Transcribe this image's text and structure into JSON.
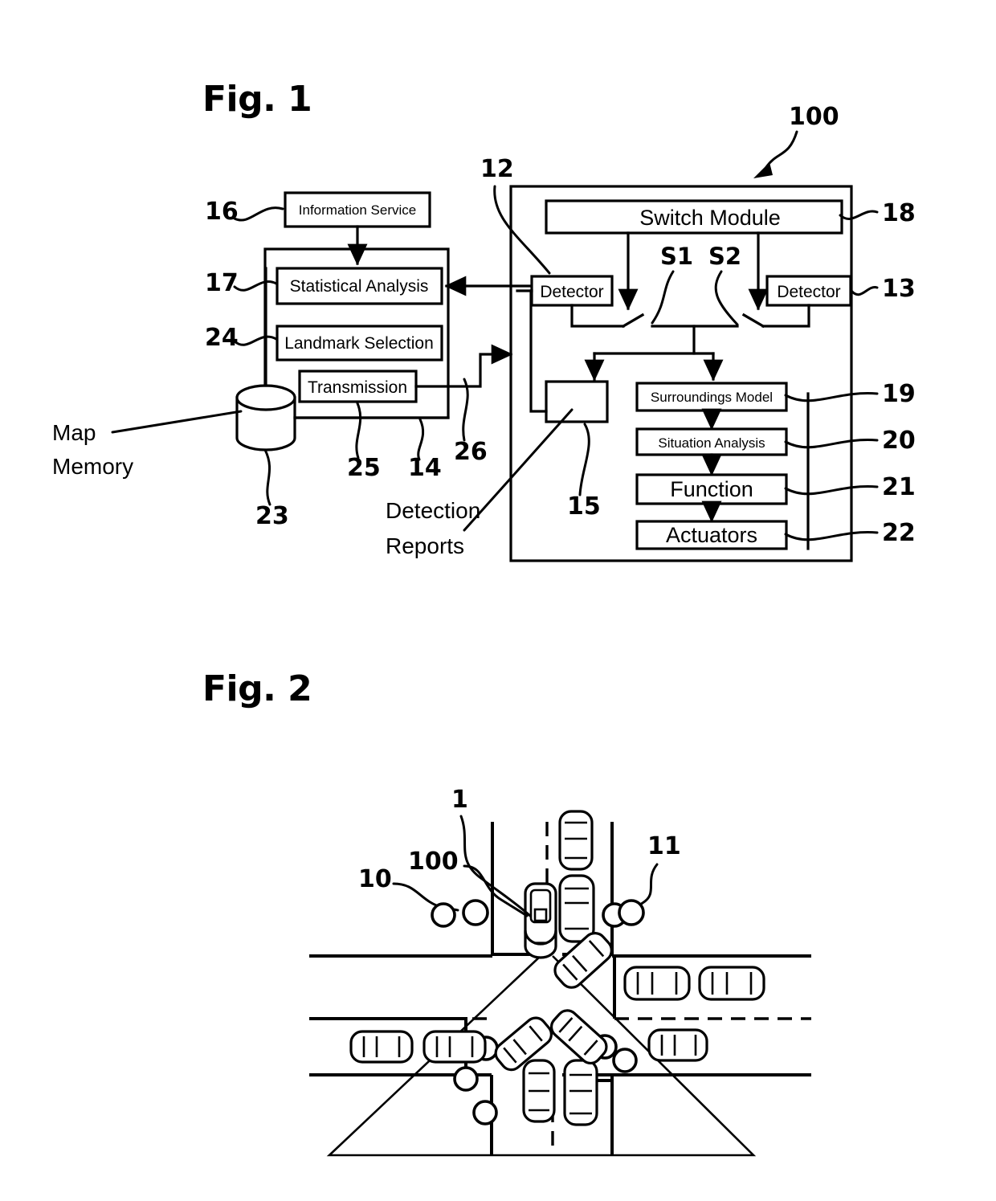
{
  "document": {
    "kind": "patent-drawing-sheet",
    "background": "#ffffff",
    "ink": "#000000"
  },
  "figures": [
    {
      "id": "fig1",
      "title": "Fig. 1",
      "caption_labels": {
        "map_memory_line1": "Map",
        "map_memory_line2": "Memory",
        "detection_reports_line1": "Detection",
        "detection_reports_line2": "Reports"
      },
      "boxes": {
        "information_service": "Information Service",
        "statistical_analysis": "Statistical Analysis",
        "landmark_selection": "Landmark Selection",
        "transmission": "Transmission",
        "switch_module": "Switch Module",
        "detector_left": "Detector",
        "detector_right": "Detector",
        "surroundings_model": "Surroundings Model",
        "situation_analysis": "Situation Analysis",
        "function": "Function",
        "actuators": "Actuators"
      },
      "signal_labels": {
        "s1": "S1",
        "s2": "S2"
      },
      "reference_numerals": {
        "system_100": "100",
        "info_service_16": "16",
        "statistical_analysis_17": "17",
        "landmark_selection_24": "24",
        "backend_unit_14": "14",
        "transmission_25": "25",
        "uplink_26": "26",
        "map_memory_23": "23",
        "detector_left_12": "12",
        "detector_right_13": "13",
        "report_block_15": "15",
        "switch_module_18": "18",
        "surroundings_model_19": "19",
        "situation_analysis_20": "20",
        "function_21": "21",
        "actuators_22": "22"
      }
    },
    {
      "id": "fig2",
      "title": "Fig. 2",
      "reference_numerals": {
        "ego_vehicle_1": "1",
        "landmark_group_10": "10",
        "onboard_system_100": "100",
        "landmark_group_11": "11"
      },
      "scene": {
        "description": "plan view of a four-way intersection with an ego vehicle and sensor field of view cone",
        "vehicle_count": 14,
        "landmark_marker_count": 10
      }
    }
  ]
}
